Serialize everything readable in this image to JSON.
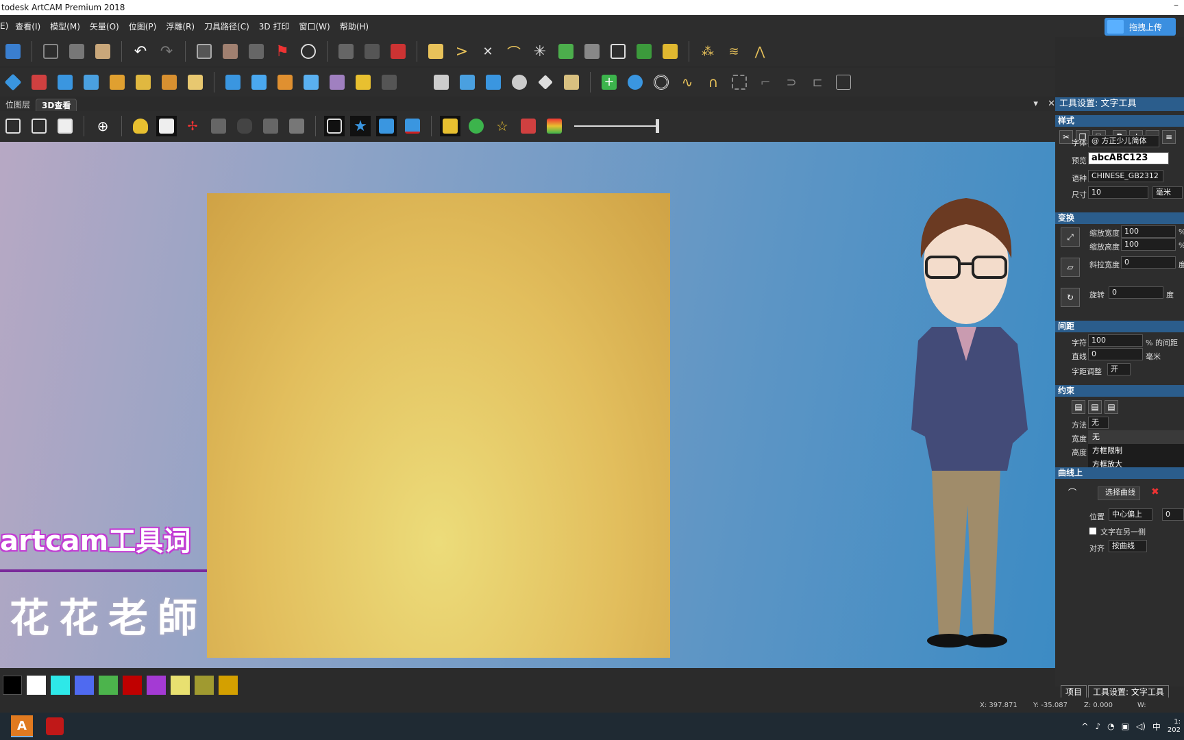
{
  "app": {
    "title": "todesk ArtCAM Premium 2018",
    "minimize": "–"
  },
  "menu": [
    "E)",
    "查看(I)",
    "模型(M)",
    "矢量(O)",
    "位图(P)",
    "浮雕(R)",
    "刀具路径(C)",
    "3D 打印",
    "窗口(W)",
    "帮助(H)"
  ],
  "upload_button": "拖拽上传",
  "view_tabs": {
    "layers": "位图层",
    "view3d": "3D查看",
    "pin": "▾",
    "close": "✕"
  },
  "canvas": {
    "title_text": "artcam工具词",
    "subtitle_text": "花花老師"
  },
  "panel": {
    "title": "工具设置: 文字工具",
    "style": {
      "header": "样式",
      "font_label": "字体",
      "font_value": "@ 方正少儿简体",
      "preview_label": "预览",
      "preview_value": "abcABC123",
      "script_label": "语种",
      "script_value": "CHINESE_GB2312",
      "size_label": "尺寸",
      "size_value": "10",
      "size_unit": "毫米"
    },
    "transform": {
      "header": "变换",
      "scale_w_label": "缩放宽度",
      "scale_w_value": "100",
      "scale_h_label": "缩放高度",
      "scale_h_value": "100",
      "skew_label": "斜拉宽度",
      "skew_value": "0",
      "skew_unit": "度",
      "rotate_label": "旋转",
      "rotate_value": "0",
      "rotate_unit": "度",
      "percent": "%"
    },
    "spacing": {
      "header": "间距",
      "char_label": "字符",
      "char_value": "100",
      "char_unit": "% 的间距",
      "line_label": "直线",
      "line_value": "0",
      "line_unit": "毫米",
      "kerning_label": "字距调整",
      "kerning_value": "开"
    },
    "constraint": {
      "header": "约束",
      "method_label": "方法",
      "method_value": "无",
      "width_label": "宽度",
      "height_label": "高度",
      "options": [
        "无",
        "方框限制",
        "方框放大"
      ]
    },
    "curve": {
      "header": "曲线上",
      "select_btn": "选择曲线",
      "position_label": "位置",
      "position_value": "中心偏上",
      "position_num": "0",
      "other_side": "文字在另一侧",
      "align_label": "对齐",
      "align_value": "按曲线"
    }
  },
  "bottom_tabs": [
    "项目",
    "工具设置: 文字工具"
  ],
  "status": {
    "x": "X: 397.871",
    "y": "Y: -35.087",
    "z": "Z: 0.000",
    "w": "W:"
  },
  "palette": [
    "#000000",
    "#ffffff",
    "#2ee8e8",
    "#4f6af0",
    "#4cb44c",
    "#c00000",
    "#a43ad4",
    "#e8e070",
    "#a09a30",
    "#d4a000"
  ],
  "tray": {
    "ime": "中",
    "time": "1:",
    "year": "202"
  }
}
